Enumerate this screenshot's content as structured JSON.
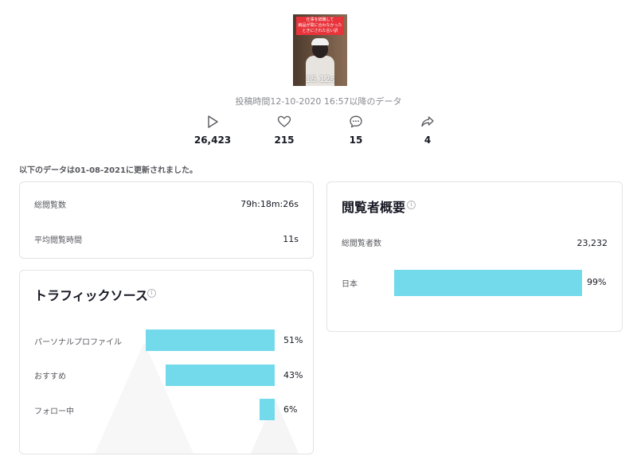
{
  "video": {
    "caption": "仕事を辞職して\n納品が間に合わなかった\nときにされた言い訳",
    "duration": "15.12s",
    "posted": "投稿時間12-10-2020 16:57以降のデータ"
  },
  "stats": {
    "views": "26,423",
    "likes": "215",
    "comments": "15",
    "shares": "4"
  },
  "updated_note": "以下のデータは01-08-2021に更新されました。",
  "watch": {
    "total_label": "総閲覧数",
    "total_value": "79h:18m:26s",
    "avg_label": "平均閲覧時間",
    "avg_value": "11s"
  },
  "traffic": {
    "title": "トラフィックソース",
    "info": "i",
    "sources": [
      {
        "label": "パーソナルプロファイル",
        "pct": "51%",
        "share": 0.51
      },
      {
        "label": "おすすめ",
        "pct": "43%",
        "share": 0.43
      },
      {
        "label": "フォロー中",
        "pct": "6%",
        "share": 0.06
      }
    ]
  },
  "audience": {
    "title": "閲覧者概要",
    "info": "i",
    "total_label": "総閲覧者数",
    "total_value": "23,232",
    "countries": [
      {
        "label": "日本",
        "pct": "99%",
        "share": 0.99
      }
    ]
  },
  "colors": {
    "bar": "#73daeb",
    "text": "#161823",
    "muted": "#8a8b91"
  },
  "icons": {
    "views": "play-icon",
    "likes": "heart-icon",
    "comments": "comment-icon",
    "shares": "share-icon"
  }
}
